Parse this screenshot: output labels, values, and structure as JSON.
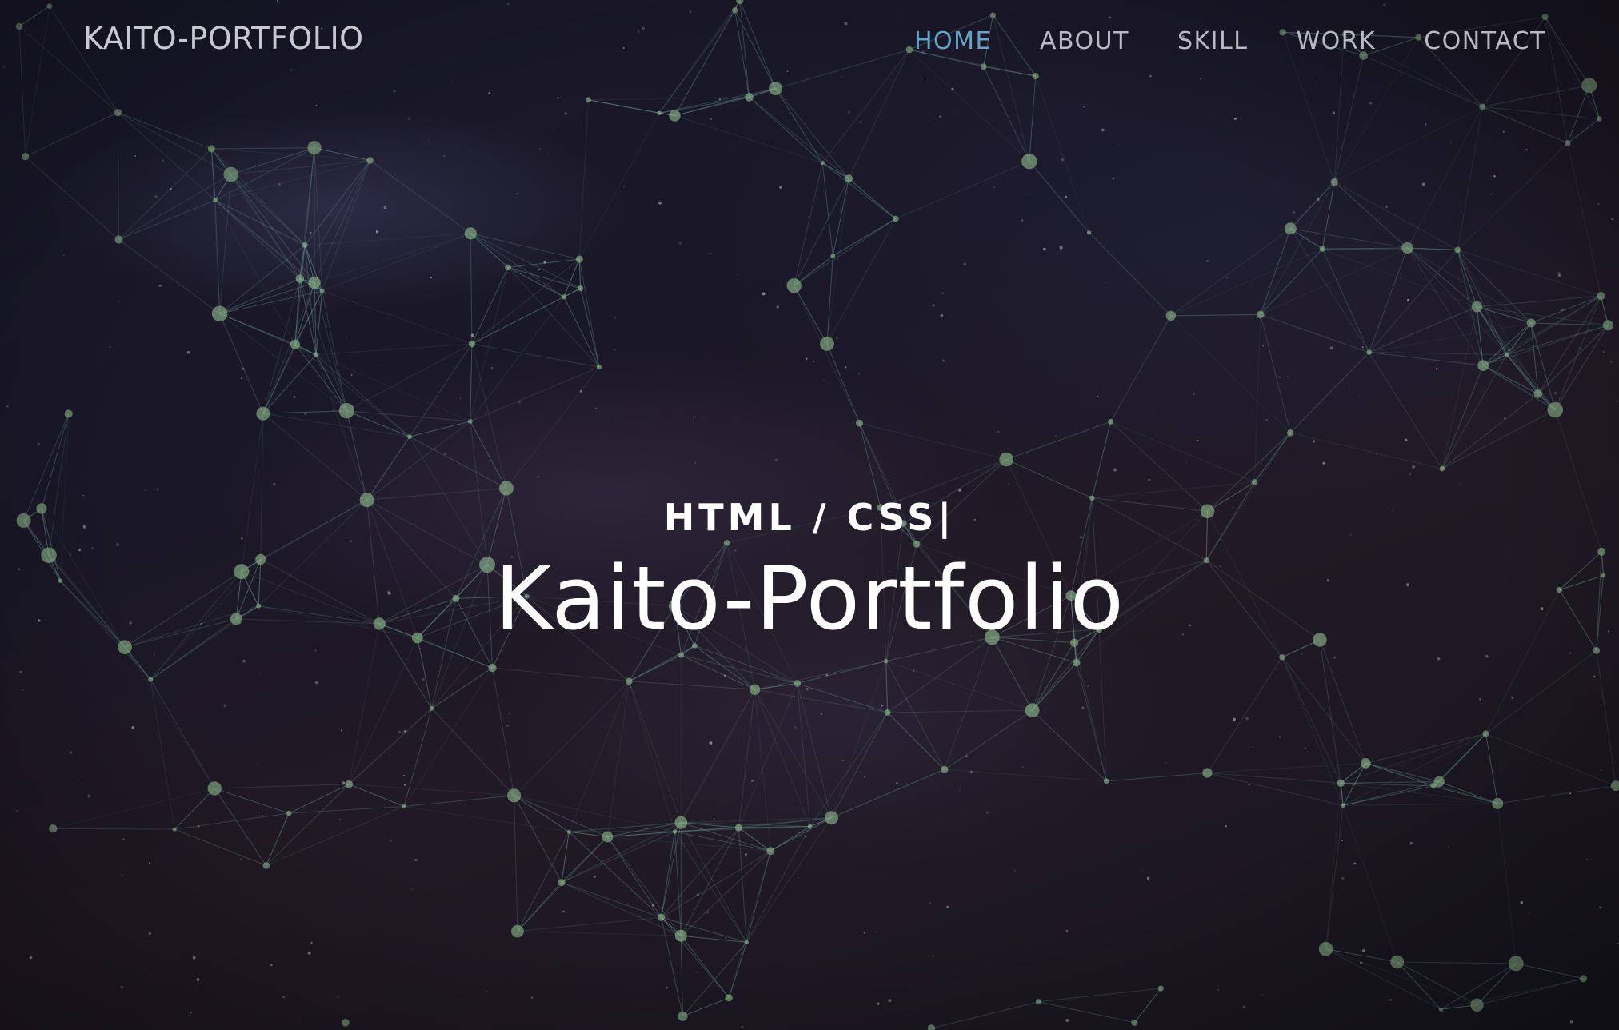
{
  "header": {
    "logo": "KAITO-PORTFOLIO",
    "nav": [
      {
        "label": "HOME",
        "active": true
      },
      {
        "label": "ABOUT",
        "active": false
      },
      {
        "label": "SKILL",
        "active": false
      },
      {
        "label": "WORK",
        "active": false
      },
      {
        "label": "CONTACT",
        "active": false
      }
    ]
  },
  "hero": {
    "subtitle": "HTML / CSS|",
    "title": "Kaito-Portfolio"
  },
  "colors": {
    "accent": "#5fa6c9",
    "nav_text": "#b9b8c3",
    "network_node": "#8fb98a",
    "network_line": "#6fa59a",
    "background": "#1a1726"
  }
}
